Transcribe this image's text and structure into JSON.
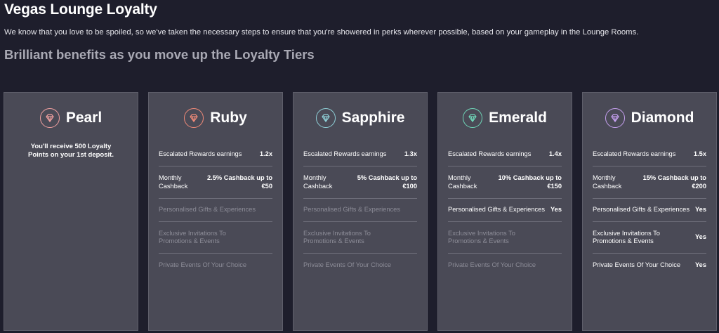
{
  "page": {
    "title": "Vegas Lounge Loyalty",
    "intro": "We know that you love to be spoiled, so we've taken the necessary steps to ensure that you're showered in perks wherever possible, based on your gameplay in the Lounge Rooms.",
    "subtitle": "Brilliant benefits as you move up the Loyalty Tiers"
  },
  "tiers": [
    {
      "name": "Pearl",
      "icon": "diamond-gem-icon",
      "color": "#f0a0a0",
      "note": "You'll receive 500 Loyalty Points on your 1st deposit."
    },
    {
      "name": "Ruby",
      "icon": "diamond-gem-icon",
      "color": "#f08a78",
      "rewards_label": "Escalated Rewards earnings",
      "rewards_value": "1.2x",
      "cashback_label": "Monthly Cashback",
      "cashback_value": "2.5% Cashback up to €50",
      "gifts_label": "Personalised Gifts & Experiences",
      "gifts_value": "",
      "invites_label": "Exclusive Invitations To Promotions & Events",
      "invites_value": "",
      "events_label": "Private Events Of Your Choice",
      "events_value": ""
    },
    {
      "name": "Sapphire",
      "icon": "diamond-gem-icon",
      "color": "#8fd0d8",
      "rewards_label": "Escalated Rewards earnings",
      "rewards_value": "1.3x",
      "cashback_label": "Monthly Cashback",
      "cashback_value": "5% Cashback up to €100",
      "gifts_label": "Personalised Gifts & Experiences",
      "gifts_value": "",
      "invites_label": "Exclusive Invitations To Promotions & Events",
      "invites_value": "",
      "events_label": "Private Events Of Your Choice",
      "events_value": ""
    },
    {
      "name": "Emerald",
      "icon": "diamond-gem-icon",
      "color": "#6fd6b8",
      "rewards_label": "Escalated Rewards earnings",
      "rewards_value": "1.4x",
      "cashback_label": "Monthly Cashback",
      "cashback_value": "10% Cashback up to €150",
      "gifts_label": "Personalised Gifts & Experiences",
      "gifts_value": "Yes",
      "invites_label": "Exclusive Invitations To Promotions & Events",
      "invites_value": "",
      "events_label": "Private Events Of Your Choice",
      "events_value": ""
    },
    {
      "name": "Diamond",
      "icon": "diamond-gem-icon",
      "color": "#c6a0f0",
      "rewards_label": "Escalated Rewards earnings",
      "rewards_value": "1.5x",
      "cashback_label": "Monthly Cashback",
      "cashback_value": "15% Cashback up to €200",
      "gifts_label": "Personalised Gifts & Experiences",
      "gifts_value": "Yes",
      "invites_label": "Exclusive Invitations To Promotions & Events",
      "invites_value": "Yes",
      "events_label": "Private Events Of Your Choice",
      "events_value": "Yes"
    }
  ]
}
